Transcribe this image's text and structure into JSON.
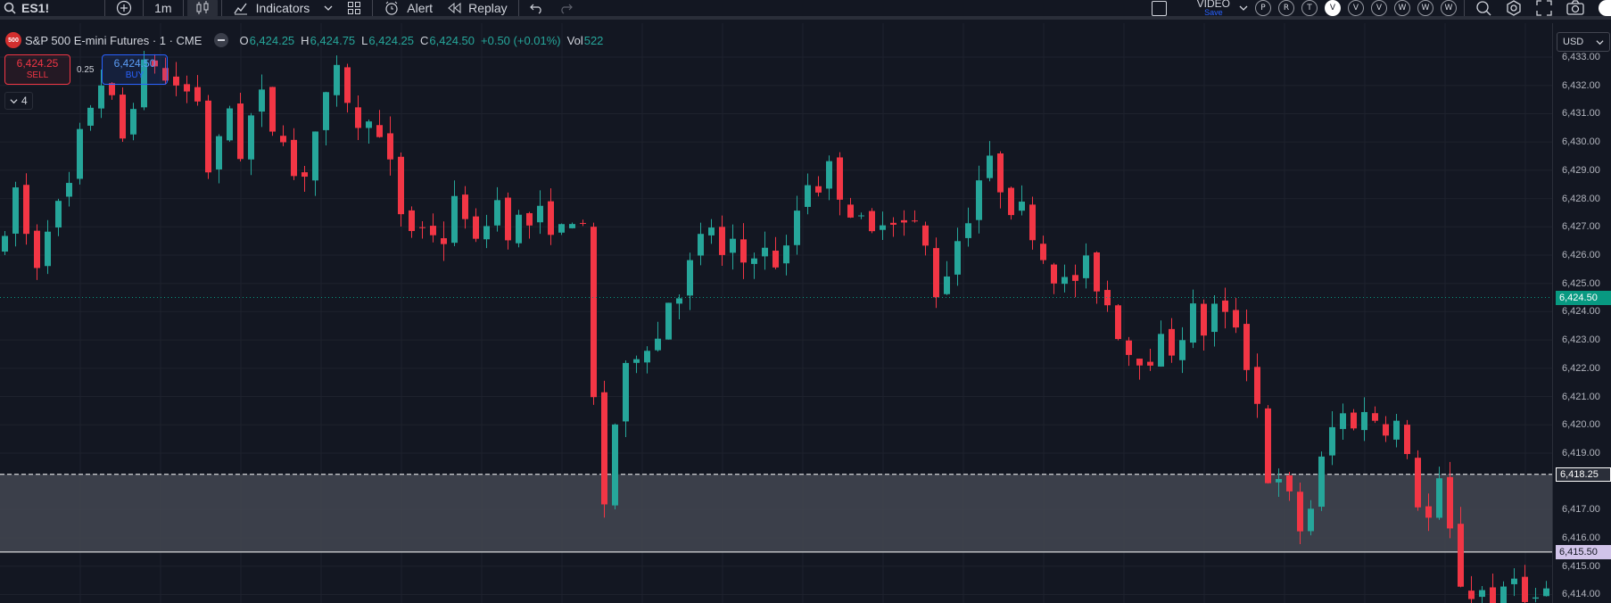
{
  "toolbar": {
    "symbol": "ES1!",
    "interval": "1m",
    "indicators_label": "Indicators",
    "alert_label": "Alert",
    "replay_label": "Replay",
    "video_label": "VIDEO",
    "save_label": "Save",
    "layout_buttons": [
      "P",
      "R",
      "T",
      "V",
      "V",
      "V",
      "W",
      "W",
      "W"
    ],
    "active_layout_index": 3
  },
  "legend": {
    "logo_text": "500",
    "title": "S&P 500 E-mini Futures · 1 · CME",
    "open_label": "O",
    "open": "6,424.25",
    "high_label": "H",
    "high": "6,424.75",
    "low_label": "L",
    "low": "6,424.25",
    "close_label": "C",
    "close": "6,424.50",
    "change": "+0.50 (+0.01%)",
    "vol_label": "Vol",
    "volume": "522"
  },
  "trading": {
    "sell_price": "6,424.25",
    "sell_label": "SELL",
    "spread": "0.25",
    "buy_price": "6,424.50",
    "buy_label": "BUY",
    "collapse_count": "4"
  },
  "price_axis": {
    "currency": "USD",
    "ticks": [
      "6,433.00",
      "6,432.00",
      "6,431.00",
      "6,430.00",
      "6,429.00",
      "6,428.00",
      "6,427.00",
      "6,426.00",
      "6,425.00",
      "6,424.00",
      "6,423.00",
      "6,422.00",
      "6,421.00",
      "6,420.00",
      "6,419.00",
      "6,417.00",
      "6,416.00",
      "6,415.00",
      "6,414.00"
    ],
    "current_price": "6,424.50",
    "zone_top_price": "6,418.25",
    "zone_bottom_price": "6,415.50"
  },
  "colors": {
    "bull": "#26a69a",
    "bear": "#f23645",
    "background": "#131722",
    "grid": "#1e222d",
    "zone_fill": "#434651",
    "current_price_tag": "#089981",
    "zone_top_tag": "#2a2e39",
    "zone_bottom_tag": "#d1c4e9"
  },
  "chart_data": {
    "type": "candlestick",
    "title": "S&P 500 E-mini Futures · 1 · CME",
    "ylim": [
      6413.7,
      6434.2
    ],
    "current_price": 6424.5,
    "zone": [
      6415.5,
      6418.25
    ],
    "path": [
      6426.3,
      6428.5,
      6427.0,
      6425.4,
      6426.8,
      6428.0,
      6427.2,
      6429.4,
      6430.5,
      6431.7,
      6432.3,
      6431.2,
      6430.1,
      6431.5,
      6432.4,
      6433.2,
      6431.9,
      6432.6,
      6431.3,
      6432.2,
      6431.1,
      6428.2,
      6430.3,
      6431.4,
      6429.6,
      6430.8,
      6431.7,
      6430.4,
      6431.1,
      6429.1,
      6428.4,
      6429.6,
      6430.9,
      6431.6,
      6432.5,
      6431.5,
      6430.2,
      6431.2,
      6430.1,
      6429.4,
      6427.9,
      6426.7,
      6427.3,
      6426.5,
      6427.1,
      6426.3,
      6428.2,
      6427.5,
      6426.1,
      6427.3,
      6428.1,
      6426.8,
      6427.5,
      6426.6,
      6427.9,
      6426.8,
      6427.4,
      6426.4,
      6427.8,
      6426.5,
      6420.4,
      6417.2,
      6419.9,
      6421.6,
      6422.4,
      6423.3,
      6422.5,
      6423.7,
      6425.1,
      6424.7,
      6425.9,
      6426.6,
      6427.1,
      6425.8,
      6426.3,
      6425.6,
      6426.4,
      6425.9,
      6426.3,
      6425.2,
      6426.8,
      6428.1,
      6428.9,
      6428.4,
      6429.1,
      6428.3,
      6427.7,
      6427.2,
      6426.3,
      6427.7,
      6427.1,
      6427.8,
      6426.5,
      6427.3,
      6425.8,
      6424.5,
      6425.6,
      6426.6,
      6427.4,
      6428.6,
      6429.3,
      6428.7,
      6428.2,
      6427.3,
      6427.8,
      6426.4,
      6425.8,
      6425.3,
      6424.9,
      6425.2,
      6425.6,
      6425.1,
      6424.5,
      6423.6,
      6422.9,
      6422.2,
      6422.8,
      6422.3,
      6423.1,
      6422.6,
      6423.4,
      6424.0,
      6423.3,
      6424.2,
      6423.6,
      6424.1,
      6422.6,
      6421.7,
      6419.8,
      6417.0,
      6418.2,
      6417.1,
      6416.2,
      6417.2,
      6418.6,
      6419.8,
      6420.4,
      6420.0,
      6420.6,
      6419.9,
      6420.7,
      6419.5,
      6420.3,
      6418.1,
      6417.2,
      6416.6,
      6417.8,
      6416.3,
      6414.6,
      6413.9,
      6414.3,
      6413.8,
      6413.6,
      6414.1,
      6414.8,
      6413.9,
      6413.7,
      6414.2,
      6413.9
    ]
  }
}
